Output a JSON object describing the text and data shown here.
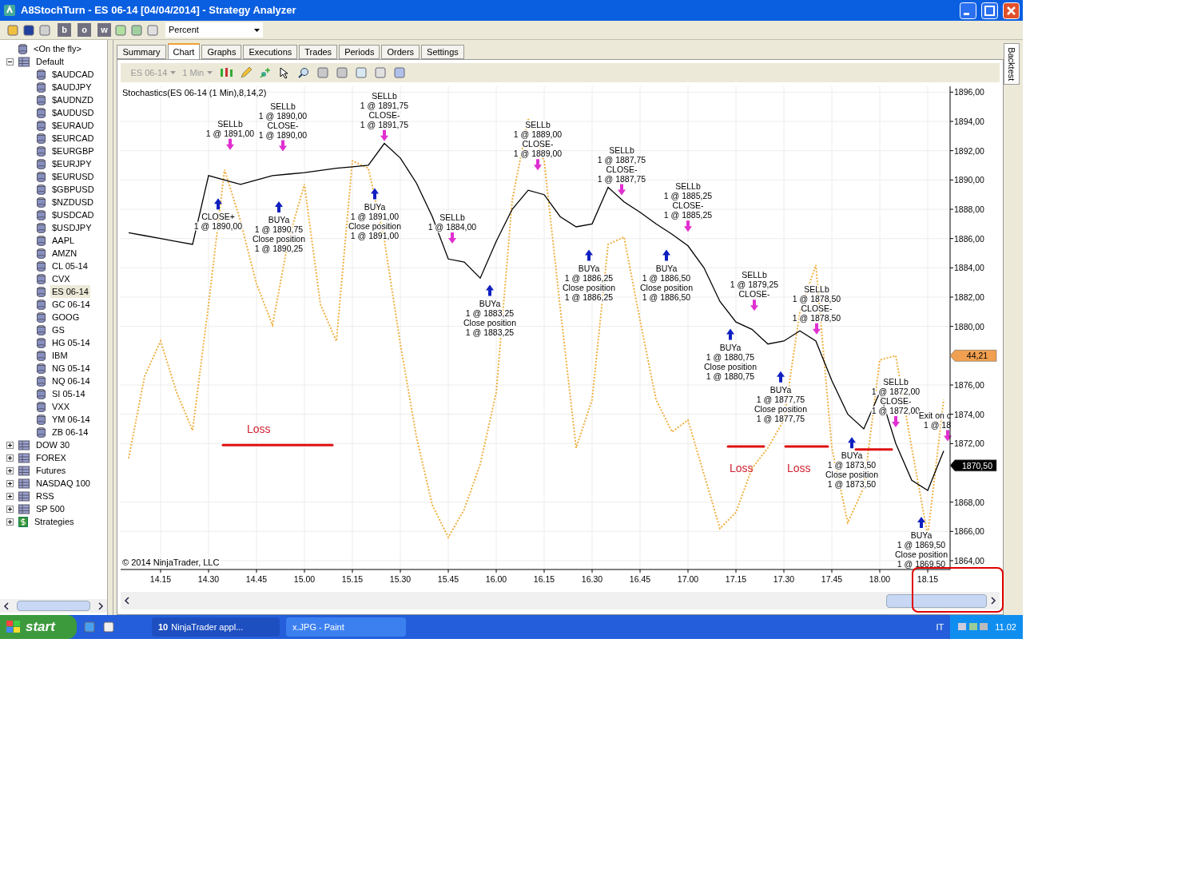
{
  "window": {
    "title": "A8StochTurn - ES 06-14 [04/04/2014] - Strategy Analyzer"
  },
  "toolbar": {
    "letter_buttons": [
      "b",
      "o",
      "w"
    ],
    "dropdown": "Percent"
  },
  "tree": [
    {
      "label": "<On the fly>",
      "kind": "list"
    },
    {
      "label": "Default",
      "kind": "folder",
      "expanded": true,
      "children": [
        {
          "label": "$AUDCAD",
          "selected": false
        },
        {
          "label": "$AUDJPY",
          "selected": false
        },
        {
          "label": "$AUDNZD",
          "selected": false
        },
        {
          "label": "$AUDUSD",
          "selected": false
        },
        {
          "label": "$EURAUD",
          "selected": false
        },
        {
          "label": "$EURCAD",
          "selected": false
        },
        {
          "label": "$EURGBP",
          "selected": false
        },
        {
          "label": "$EURJPY",
          "selected": false
        },
        {
          "label": "$EURUSD",
          "selected": false
        },
        {
          "label": "$GBPUSD",
          "selected": false
        },
        {
          "label": "$NZDUSD",
          "selected": false
        },
        {
          "label": "$USDCAD",
          "selected": false
        },
        {
          "label": "$USDJPY",
          "selected": false
        },
        {
          "label": "AAPL",
          "selected": false
        },
        {
          "label": "AMZN",
          "selected": false
        },
        {
          "label": "CL 05-14",
          "selected": false
        },
        {
          "label": "CVX",
          "selected": false
        },
        {
          "label": "ES 06-14",
          "selected": true
        },
        {
          "label": "GC 06-14",
          "selected": false
        },
        {
          "label": "GOOG",
          "selected": false
        },
        {
          "label": "GS",
          "selected": false
        },
        {
          "label": "HG 05-14",
          "selected": false
        },
        {
          "label": "IBM",
          "selected": false
        },
        {
          "label": "NG 05-14",
          "selected": false
        },
        {
          "label": "NQ 06-14",
          "selected": false
        },
        {
          "label": "SI 05-14",
          "selected": false
        },
        {
          "label": "VXX",
          "selected": false
        },
        {
          "label": "YM 06-14",
          "selected": false
        },
        {
          "label": "ZB 06-14",
          "selected": false
        }
      ]
    },
    {
      "label": "DOW 30",
      "kind": "folder",
      "expanded": false
    },
    {
      "label": "FOREX",
      "kind": "folder",
      "expanded": false
    },
    {
      "label": "Futures",
      "kind": "folder",
      "expanded": false
    },
    {
      "label": "NASDAQ 100",
      "kind": "folder",
      "expanded": false
    },
    {
      "label": "RSS",
      "kind": "folder",
      "expanded": false
    },
    {
      "label": "SP 500",
      "kind": "folder",
      "expanded": false
    },
    {
      "label": "Strategies",
      "kind": "strategy",
      "expanded": false
    }
  ],
  "tabs": [
    {
      "label": "Summary",
      "selected": false
    },
    {
      "label": "Chart",
      "selected": true
    },
    {
      "label": "Graphs",
      "selected": false
    },
    {
      "label": "Executions",
      "selected": false
    },
    {
      "label": "Trades",
      "selected": false
    },
    {
      "label": "Periods",
      "selected": false
    },
    {
      "label": "Orders",
      "selected": false
    },
    {
      "label": "Settings",
      "selected": false
    }
  ],
  "chart_toolbar": {
    "instrument": "ES 06-14",
    "interval": "1 Min",
    "disabled": true
  },
  "chart": {
    "title": "Stochastics(ES 06-14 (1 Min),8,14,2)",
    "copyright": "© 2014 NinjaTrader, LLC",
    "chart_data": {
      "type": "line",
      "grid": true,
      "ylim": [
        1863.4,
        1896.4
      ],
      "categories": [
        null,
        null,
        "14.15",
        null,
        null,
        "14.30",
        null,
        null,
        "14.45",
        null,
        null,
        "15.00",
        null,
        null,
        "15.15",
        null,
        null,
        "15.30",
        null,
        null,
        "15.45",
        null,
        null,
        "16.00",
        null,
        null,
        "16.15",
        null,
        null,
        "16.30",
        null,
        null,
        "16.45",
        null,
        null,
        "17.00",
        null,
        null,
        "17.15",
        null,
        null,
        "17.30",
        null,
        null,
        "17.45",
        null,
        null,
        "18.00",
        null,
        null,
        "18.15",
        null
      ],
      "yticks": [
        {
          "value": 1864,
          "label": "1864,00"
        },
        {
          "value": 1866,
          "label": "1866,00"
        },
        {
          "value": 1868,
          "label": "1868,00"
        },
        {
          "value": 1872,
          "label": "1872,00"
        },
        {
          "value": 1874,
          "label": "1874,00"
        },
        {
          "value": 1876,
          "label": "1876,00"
        },
        {
          "value": 1880,
          "label": "1880,00"
        },
        {
          "value": 1882,
          "label": "1882,00"
        },
        {
          "value": 1884,
          "label": "1884,00"
        },
        {
          "value": 1886,
          "label": "1886,00"
        },
        {
          "value": 1888,
          "label": "1888,00"
        },
        {
          "value": 1890,
          "label": "1890,00"
        },
        {
          "value": 1892,
          "label": "1892,00"
        },
        {
          "value": 1894,
          "label": "1894,00"
        },
        {
          "value": 1896,
          "label": "1896,00"
        }
      ],
      "series": [
        {
          "color": "#000000",
          "line_style": "solid",
          "values": [
            1886.4,
            1886.2,
            1886.0,
            1885.8,
            1885.6,
            1890.3,
            1890.0,
            1889.7,
            1890.0,
            1890.3,
            1890.4,
            1890.5,
            1890.65,
            1890.8,
            1890.9,
            1891.0,
            1892.5,
            1891.5,
            1889.8,
            1887.5,
            1884.6,
            1884.4,
            1883.3,
            1885.8,
            1888.0,
            1889.3,
            1889.0,
            1887.5,
            1886.8,
            1887.0,
            1889.5,
            1888.5,
            1887.8,
            1887.0,
            1886.3,
            1885.5,
            1884.0,
            1881.7,
            1880.3,
            1879.8,
            1878.8,
            1879.0,
            1879.7,
            1879.0,
            1876.3,
            1874.0,
            1873.0,
            1875.5,
            1872.0,
            1869.5,
            1868.8,
            1871.5
          ]
        },
        {
          "color": "#f0b040",
          "line_style": "dotted",
          "values": [
            1871.0,
            1876.6,
            1879.0,
            1875.5,
            1872.9,
            1881.5,
            1890.7,
            1887.2,
            1882.9,
            1880.1,
            1885.9,
            1889.7,
            1881.5,
            1879.0,
            1891.3,
            1890.8,
            1885.9,
            1878.8,
            1872.5,
            1867.8,
            1865.6,
            1867.5,
            1870.6,
            1875.5,
            1888.6,
            1894.2,
            1891.3,
            1881.3,
            1871.7,
            1875.0,
            1885.6,
            1886.1,
            1880.4,
            1875.0,
            1872.8,
            1873.6,
            1869.9,
            1866.2,
            1867.3,
            1870.3,
            1871.7,
            1873.6,
            1881.0,
            1884.2,
            1871.7,
            1866.6,
            1869.0,
            1877.7,
            1878.0,
            1871.7,
            1865.7,
            1875.0
          ]
        }
      ]
    },
    "trade_markers": [
      {
        "kind": "sell",
        "lines": [
          "SELLb",
          "1 @ 1891,00"
        ]
      },
      {
        "kind": "sell",
        "lines": [
          "SELLb",
          "1 @ 1890,00",
          "CLOSE-",
          "1 @ 1890,00"
        ]
      },
      {
        "kind": "sell",
        "lines": [
          "SELLb",
          "1 @ 1891,75",
          "CLOSE-",
          "1 @ 1891,75"
        ]
      },
      {
        "kind": "sell",
        "lines": [
          "SELLb",
          "1 @ 1884,00"
        ]
      },
      {
        "kind": "sell",
        "lines": [
          "SELLb",
          "1 @ 1889,00",
          "CLOSE-",
          "1 @ 1889,00"
        ]
      },
      {
        "kind": "sell",
        "lines": [
          "SELLb",
          "1 @ 1887,75",
          "CLOSE-",
          "1 @ 1887,75"
        ]
      },
      {
        "kind": "sell",
        "lines": [
          "SELLb",
          "1 @ 1885,25",
          "CLOSE-",
          "1 @ 1885,25"
        ]
      },
      {
        "kind": "sell",
        "lines": [
          "SELLb",
          "1 @ 1879,25",
          "CLOSE-"
        ]
      },
      {
        "kind": "sell",
        "lines": [
          "SELLb",
          "1 @ 1878,50",
          "CLOSE-",
          "1 @ 1878,50"
        ]
      },
      {
        "kind": "sell",
        "lines": [
          "SELLb",
          "1 @ 1872,00",
          "CLOSE-",
          "1 @ 1872,00"
        ]
      },
      {
        "kind": "sell",
        "lines": [
          "Exit on c",
          "1 @ 18"
        ]
      },
      {
        "kind": "buy",
        "lines": [
          "CLOSE+",
          "1 @ 1890,00"
        ]
      },
      {
        "kind": "buy",
        "lines": [
          "BUYa",
          "1 @ 1890,75",
          "Close position",
          "1 @ 1890,25"
        ]
      },
      {
        "kind": "buy",
        "lines": [
          "BUYa",
          "1 @ 1891,00",
          "Close position",
          "1 @ 1891,00"
        ]
      },
      {
        "kind": "buy",
        "lines": [
          "BUYa",
          "1 @ 1883,25",
          "Close position",
          "1 @ 1883,25"
        ]
      },
      {
        "kind": "buy",
        "lines": [
          "BUYa",
          "1 @ 1886,25",
          "Close position",
          "1 @ 1886,25"
        ]
      },
      {
        "kind": "buy",
        "lines": [
          "BUYa",
          "1 @ 1886,50",
          "Close position",
          "1 @ 1886,50"
        ]
      },
      {
        "kind": "buy",
        "lines": [
          "BUYa",
          "1 @ 1880,75",
          "Close position",
          "1 @ 1880,75"
        ]
      },
      {
        "kind": "buy",
        "lines": [
          "BUYa",
          "1 @ 1877,75",
          "Close position",
          "1 @ 1877,75"
        ]
      },
      {
        "kind": "buy",
        "lines": [
          "BUYa",
          "1 @ 1873,50",
          "Close position",
          "1 @ 1873,50"
        ]
      },
      {
        "kind": "buy",
        "lines": [
          "BUYa",
          "1 @ 1869,50",
          "Close position",
          "1 @ 1869,50"
        ]
      }
    ],
    "loss_marks": [
      {
        "kind": "labeled",
        "text": "Loss"
      },
      {
        "kind": "labeled",
        "text": "Loss"
      },
      {
        "kind": "labeled",
        "text": "Loss"
      },
      {
        "kind": "plain"
      }
    ],
    "price_tags": [
      {
        "kind": "indicator",
        "text": "44,21"
      },
      {
        "kind": "last",
        "text": "1870,50"
      }
    ]
  },
  "right_tab": "Backtest",
  "taskbar": {
    "start": "start",
    "tasks": [
      {
        "count": "10",
        "label": "NinjaTrader appl...",
        "selected": false
      },
      {
        "label": "x.JPG - Paint",
        "selected": true
      }
    ],
    "language": "IT",
    "clock": "11.02"
  }
}
